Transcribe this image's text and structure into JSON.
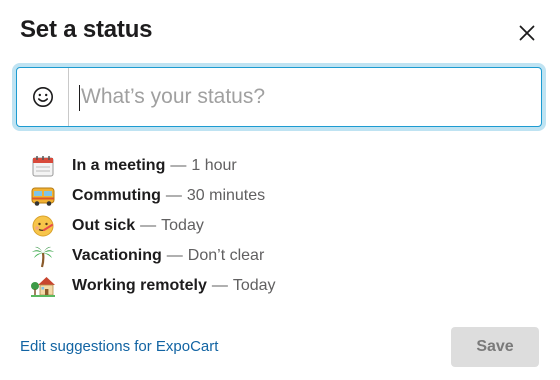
{
  "dialog": {
    "title": "Set a status",
    "close_icon": "close-icon"
  },
  "status_input": {
    "value": "",
    "placeholder": "What’s your status?",
    "emoji_icon": "smiley-face-icon",
    "focus_ring_color": "#1d9bd1"
  },
  "suggestions": [
    {
      "icon": "calendar-icon",
      "label": "In a meeting",
      "separator": "—",
      "duration": "1 hour"
    },
    {
      "icon": "bus-icon",
      "label": "Commuting",
      "separator": "—",
      "duration": "30 minutes"
    },
    {
      "icon": "face-with-thermometer-icon",
      "label": "Out sick",
      "separator": "—",
      "duration": "Today"
    },
    {
      "icon": "palm-tree-icon",
      "label": "Vacationing",
      "separator": "—",
      "duration": "Don’t clear"
    },
    {
      "icon": "house-with-garden-icon",
      "label": "Working remotely",
      "separator": "—",
      "duration": "Today"
    }
  ],
  "footer": {
    "edit_link": "Edit suggestions for ExpoCart",
    "save_label": "Save",
    "link_color": "#1264a3"
  }
}
